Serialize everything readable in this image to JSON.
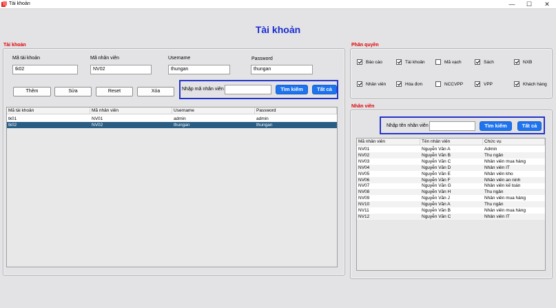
{
  "window": {
    "title": "Tài khoản",
    "minimize": "—",
    "maximize": "☐",
    "close": "✕"
  },
  "heading": "Tài khoản",
  "account_group": {
    "label": "Tài khoản",
    "fields": {
      "account_id": {
        "label": "Mã tài khoản",
        "value": "tk02"
      },
      "employee_id": {
        "label": "Mã nhân viên",
        "value": "NV02"
      },
      "username": {
        "label": "Username",
        "value": "thungan"
      },
      "password": {
        "label": "Password",
        "value": "thungan"
      }
    },
    "buttons": {
      "add": "Thêm",
      "edit": "Sửa",
      "reset": "Reset",
      "delete": "Xóa"
    },
    "search": {
      "label": "Nhập mã nhân viên",
      "value": "",
      "search_button": "Tìm kiếm",
      "all_button": "Tất cả"
    },
    "table": {
      "headers": [
        "Mã tài khoản",
        "Mã nhân viên",
        "Username",
        "Password"
      ],
      "rows": [
        [
          "tk01",
          "NV01",
          "admin",
          "admin"
        ],
        [
          "tk02",
          "NV02",
          "thungan",
          "thungan"
        ]
      ],
      "selected_row": 1
    }
  },
  "permission_group": {
    "label": "Phân quyền",
    "items": [
      {
        "label": "Báo cáo",
        "checked": true
      },
      {
        "label": "Tài khoản",
        "checked": true
      },
      {
        "label": "Mã vạch",
        "checked": false
      },
      {
        "label": "Sách",
        "checked": true
      },
      {
        "label": "NXB",
        "checked": true
      },
      {
        "label": "Nhân viên",
        "checked": true
      },
      {
        "label": "Hóa đơn",
        "checked": true
      },
      {
        "label": "NCCVPP",
        "checked": false
      },
      {
        "label": "VPP",
        "checked": true
      },
      {
        "label": "Khách hàng",
        "checked": true
      }
    ]
  },
  "employee_group": {
    "label": "Nhân viên",
    "search": {
      "label": "Nhập tên nhân viên",
      "value": "",
      "search_button": "Tìm kiếm",
      "all_button": "Tất cả"
    },
    "table": {
      "headers": [
        "Mã nhân viên",
        "Tên nhân viên",
        "Chức vụ"
      ],
      "rows": [
        [
          "NV01",
          "Nguyễn Văn A",
          "Admin"
        ],
        [
          "NV02",
          "Nguyễn Văn B",
          "Thu ngân"
        ],
        [
          "NV03",
          "Nguyễn Văn C",
          "Nhân viên mua hàng"
        ],
        [
          "NV04",
          "Nguyễn Văn D",
          "Nhân viên IT"
        ],
        [
          "NV05",
          "Nguyễn Văn E",
          "Nhân viên kho"
        ],
        [
          "NV06",
          "Nguyễn Văn F",
          "Nhân viên an ninh"
        ],
        [
          "NV07",
          "Nguyễn Văn G",
          "Nhân viên kế toán"
        ],
        [
          "NV08",
          "Nguyễn Văn H",
          "Thu ngân"
        ],
        [
          "NV09",
          "Nguyễn Văn J",
          "Nhân viên mua hàng"
        ],
        [
          "NV10",
          "Nguyễn Văn A",
          "Thu ngân"
        ],
        [
          "NV11",
          "Nguyễn Văn B",
          "Nhân viên mua hàng"
        ],
        [
          "NV12",
          "Nguyễn Văn C",
          "Nhân viên IT"
        ]
      ]
    }
  },
  "colors": {
    "heading": "#1a2bd0",
    "group_label": "#e00000",
    "accent_button": "#1e73ee",
    "selected_row": "#2a5d84",
    "search_border": "#2233c8"
  }
}
